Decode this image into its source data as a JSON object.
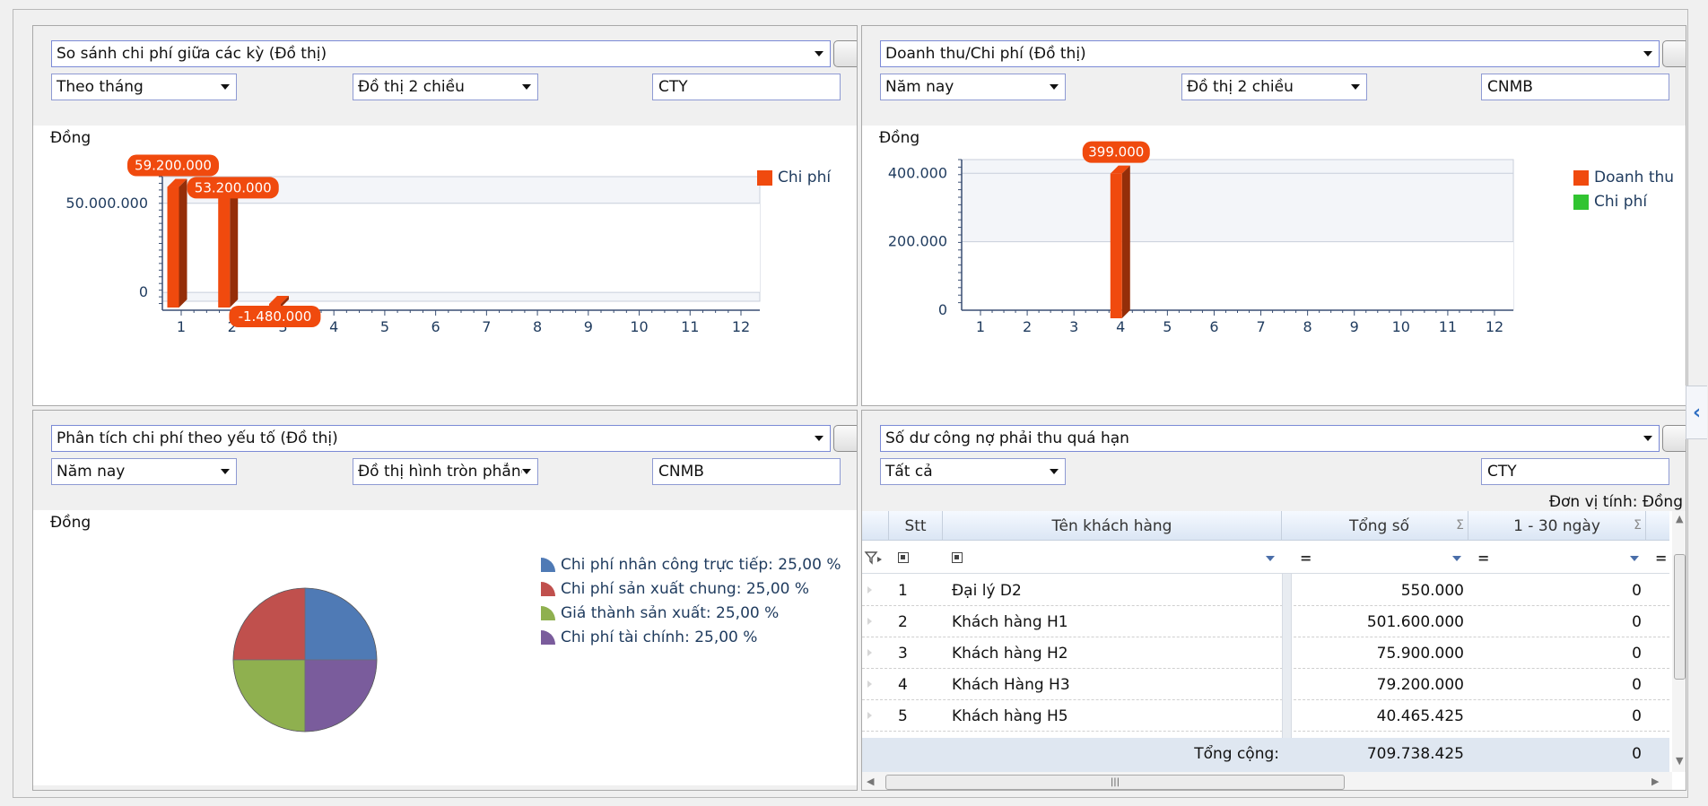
{
  "panel1": {
    "title": "So sánh chi phí giữa các kỳ (Đồ thị)",
    "period": "Theo tháng",
    "chart_type": "Đồ thị 2 chiều",
    "unit_code": "CTY",
    "unit_label": "Đồng",
    "chart_data": {
      "type": "bar",
      "categories": [
        "1",
        "2",
        "3",
        "4",
        "5",
        "6",
        "7",
        "8",
        "9",
        "10",
        "11",
        "12"
      ],
      "series": [
        {
          "name": "Chi phí",
          "color": "#f04a0e",
          "values": [
            59200000,
            53200000,
            -1480000,
            null,
            null,
            null,
            null,
            null,
            null,
            null,
            null,
            null
          ]
        }
      ],
      "data_labels": [
        "59.200.000",
        "53.200.000",
        "-1.480.000"
      ],
      "y_ticks": [
        "0",
        "50.000.000"
      ],
      "ylim": [
        -5000000,
        65000000
      ],
      "legend": "top-right",
      "grid": true
    }
  },
  "panel2": {
    "title": "Doanh thu/Chi phí (Đồ thị)",
    "period": "Năm nay",
    "chart_type": "Đồ thị 2 chiều",
    "unit_code": "CNMB",
    "unit_label": "Đồng",
    "chart_data": {
      "type": "bar",
      "categories": [
        "1",
        "2",
        "3",
        "4",
        "5",
        "6",
        "7",
        "8",
        "9",
        "10",
        "11",
        "12"
      ],
      "series": [
        {
          "name": "Doanh thu",
          "color": "#f04a0e",
          "values": [
            null,
            null,
            null,
            399000,
            null,
            null,
            null,
            null,
            null,
            null,
            null,
            null
          ]
        },
        {
          "name": "Chi phí",
          "color": "#31c431",
          "values": [
            null,
            null,
            null,
            null,
            null,
            null,
            null,
            null,
            null,
            null,
            null,
            null
          ]
        }
      ],
      "data_labels": [
        "399.000"
      ],
      "y_ticks": [
        "0",
        "200.000",
        "400.000"
      ],
      "ylim": [
        0,
        440000
      ],
      "legend": "top-right",
      "grid": true
    }
  },
  "panel3": {
    "title": "Phân tích chi phí theo yếu tố (Đồ thị)",
    "period": "Năm nay",
    "chart_type": "Đồ thị hình tròn phẳng",
    "unit_code": "CNMB",
    "unit_label": "Đồng",
    "chart_data": {
      "type": "pie",
      "slices": [
        {
          "label": "Chi phí nhân công trực tiếp: 25,00 %",
          "value": 25,
          "color": "#4f7ab5"
        },
        {
          "label": "Chi phí sản xuất chung: 25,00 %",
          "value": 25,
          "color": "#c0504d"
        },
        {
          "label": "Giá thành sản xuất: 25,00 %",
          "value": 25,
          "color": "#8fb04f"
        },
        {
          "label": "Chi phí tài chính: 25,00 %",
          "value": 25,
          "color": "#7a5c9c"
        }
      ],
      "legend": "right"
    }
  },
  "panel4": {
    "title": "Số dư công nợ phải thu quá hạn",
    "filter": "Tất cả",
    "unit_code": "CTY",
    "unit_note": "Đơn vị tính: Đồng",
    "columns": {
      "stt": "Stt",
      "name": "Tên khách hàng",
      "total": "Tổng số",
      "d1_30": "1 - 30 ngày"
    },
    "rows": [
      {
        "stt": "1",
        "name": "Đại lý D2",
        "total": "550.000",
        "d1_30": "0"
      },
      {
        "stt": "2",
        "name": "Khách hàng H1",
        "total": "501.600.000",
        "d1_30": "0"
      },
      {
        "stt": "3",
        "name": "Khách hàng H2",
        "total": "75.900.000",
        "d1_30": "0"
      },
      {
        "stt": "4",
        "name": "Khách Hàng H3",
        "total": "79.200.000",
        "d1_30": "0"
      },
      {
        "stt": "5",
        "name": "Khách hàng H5",
        "total": "40.465.425",
        "d1_30": "0"
      }
    ],
    "footer": {
      "label": "Tổng cộng:",
      "total": "709.738.425",
      "d1_30": "0"
    }
  },
  "icons": {
    "collapse": "chevron-left-icon"
  },
  "colors": {
    "accent": "#f04a0e",
    "border_focus": "#7b8ad6",
    "header_bg": "#dbe6f4"
  }
}
